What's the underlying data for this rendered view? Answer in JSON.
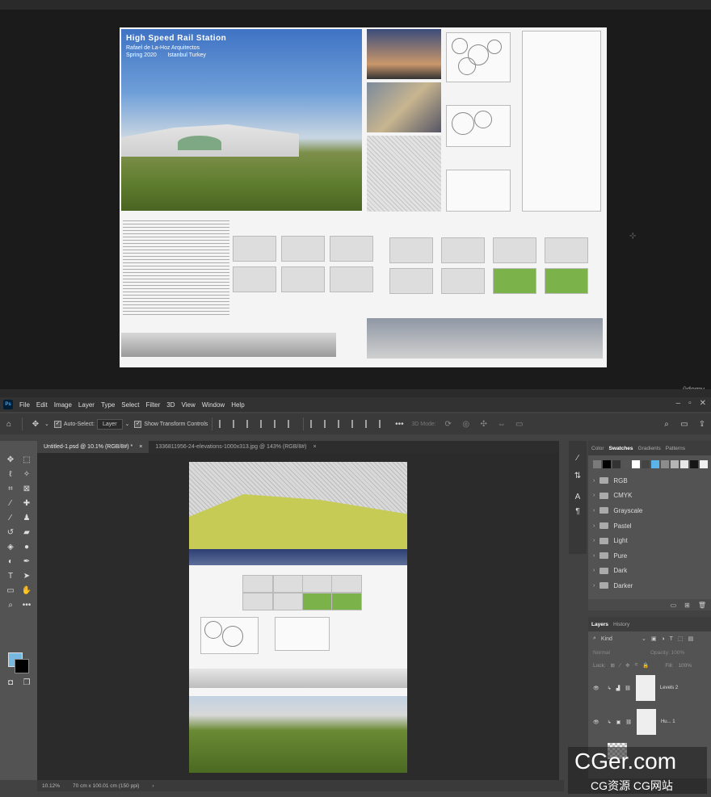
{
  "reference": {
    "board_title": "High Speed Rail Station",
    "board_subtitle": "Rafael de La-Hoz Arquitectos\nSpring 2020       Istanbul Turkey",
    "watermark_brand": "ûdemy"
  },
  "menu": {
    "app_icon": "Ps",
    "items": [
      "File",
      "Edit",
      "Image",
      "Layer",
      "Type",
      "Select",
      "Filter",
      "3D",
      "View",
      "Window",
      "Help"
    ]
  },
  "options": {
    "auto_select_label": "Auto-Select:",
    "auto_select_target": "Layer",
    "transform_label": "Show Transform Controls",
    "mode_3d": "3D Mode:"
  },
  "tabs": [
    {
      "label": "Untitled-1.psd @ 10.1% (RGB/8#) *",
      "close": "×"
    },
    {
      "label": "1336811956-24-elevations-1000x313.jpg @ 143% (RGB/8#)",
      "close": "×"
    }
  ],
  "status": {
    "zoom": "10.12%",
    "doc_info": "70 cm x 100.01 cm (150 ppi)",
    "arrow": "›"
  },
  "swatches_panel": {
    "tabs": [
      "Color",
      "Swatches",
      "Gradients",
      "Patterns"
    ],
    "active_tab": "Swatches",
    "colors": [
      "#7a7a7a",
      "#000000",
      "#333333",
      "#555555",
      "#ffffff",
      "#444444",
      "#5ab4ea",
      "#8c8c8c",
      "#b5b5b5",
      "#e6e6e6",
      "#151515",
      "#f1f1f1"
    ],
    "folders": [
      "RGB",
      "CMYK",
      "Grayscale",
      "Pastel",
      "Light",
      "Pure",
      "Dark",
      "Darker"
    ]
  },
  "layers_panel": {
    "tabs": [
      "Layers",
      "History"
    ],
    "filter": "Kind",
    "blend": "Normal",
    "opacity_label": "Opacity:",
    "opacity_value": "100%",
    "lock_label": "Lock:",
    "fill_label": "Fill:",
    "fill_value": "100%",
    "layers": [
      {
        "name": "Levels 2"
      },
      {
        "name": "Hu... 1"
      }
    ]
  },
  "watermark": {
    "main": "CGer.com",
    "sub": "CG资源 CG网站"
  }
}
